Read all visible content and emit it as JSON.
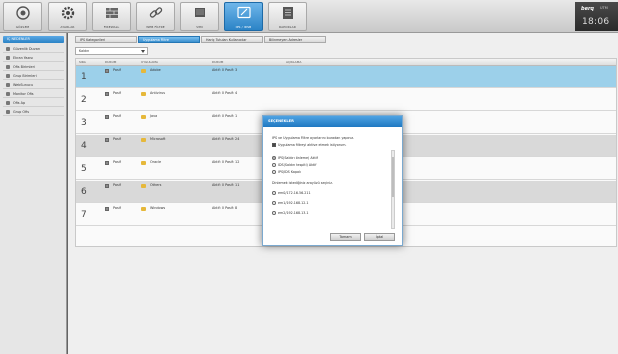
{
  "toolbar": {
    "items": [
      {
        "label": "GÖZLEM",
        "icon": "home-icon"
      },
      {
        "label": "AYARLAR",
        "icon": "gear-icon"
      },
      {
        "label": "FIREWALL",
        "icon": "firewall-icon"
      },
      {
        "label": "WEB FİLTRE",
        "icon": "link-icon"
      },
      {
        "label": "VPN",
        "icon": "vpn-icon"
      },
      {
        "label": "IPS / IDSB",
        "icon": "ips-icon"
      },
      {
        "label": "RAPORLAR",
        "icon": "report-icon"
      }
    ],
    "active_index": 5,
    "brand": "berq",
    "brand_suffix": "UTM",
    "clock": "18:06"
  },
  "sidebar": {
    "header": "IÇ NEDENLER",
    "items": [
      "Güvenlik Duvarı",
      "Ekran Yazısı",
      "Ofis Birimleri",
      "Grup Birimleri",
      "WebSunucu",
      "Monitor Ofis",
      "Ofis Ap",
      "Grup Ofis"
    ]
  },
  "main": {
    "tabs": [
      "IPS Kategorileri",
      "Uygulama Filtre",
      "Hariç Tutulan Kullanıcılar",
      "Bilinmeyen Adresler"
    ],
    "active_tab": 1,
    "filter_value": "Kaldırı",
    "columns": [
      "SIRA",
      "DURUM",
      "UYGULAMA",
      "DURUM",
      "AÇIKLAMA"
    ],
    "rows": [
      {
        "num": "1",
        "status": "Pasif",
        "name": "Adobe",
        "desc": "Aktif: 0 Pasif: 3"
      },
      {
        "num": "2",
        "status": "Pasif",
        "name": "Antivirus",
        "desc": "Aktif: 0 Pasif: 4"
      },
      {
        "num": "3",
        "status": "Pasif",
        "name": "Java",
        "desc": "Aktif: 0 Pasif: 1"
      },
      {
        "num": "4",
        "status": "Pasif",
        "name": "Microsoft",
        "desc": "Aktif: 0 Pasif: 24"
      },
      {
        "num": "5",
        "status": "Pasif",
        "name": "Oracle",
        "desc": "Aktif: 0 Pasif: 12"
      },
      {
        "num": "6",
        "status": "Pasif",
        "name": "Others",
        "desc": "Aktif: 0 Pasif: 11"
      },
      {
        "num": "7",
        "status": "Pasif",
        "name": "Windows",
        "desc": "Aktif: 0 Pasif: 8"
      }
    ],
    "selected_row": 0
  },
  "modal": {
    "title": "SEÇENEKLER",
    "description": "IPS ve Uygulama Filtre ayarlarını buradan yapınız.",
    "checkbox_label": "Uygulama filtreyi aktive etmek istiyorum.",
    "mode_options": [
      "IPS(Saldırı önleme) Aktif",
      "IDS(Saldırı tespiti) Aktif",
      "IPS/IDS Kapalı"
    ],
    "mode_selected": 0,
    "interface_label": "Dinlemek istediğiniz arayüzü seçiniz.",
    "interfaces": [
      "em0/172.16.56.211",
      "em1/192.168.12.1",
      "em2/192.168.13.1"
    ],
    "ok_label": "Tamam",
    "cancel_label": "İptal"
  },
  "colors": {
    "accent": "#2b83c6",
    "selected_row": "#9cd0ea",
    "folder": "#e6b83a"
  }
}
